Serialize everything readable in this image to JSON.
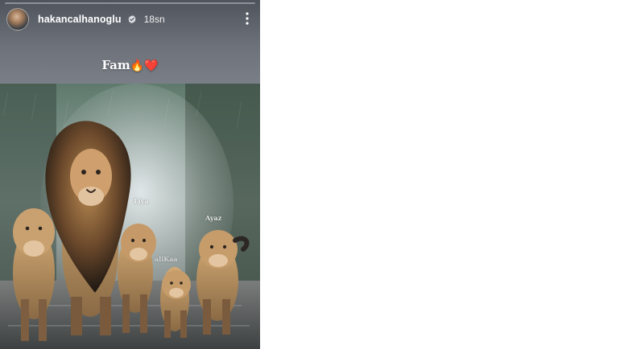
{
  "story": {
    "progress": 0.0,
    "user": {
      "username": "hakancalhanoglu",
      "verified": true,
      "time_ago": "18sn"
    },
    "caption": {
      "text": "Fam",
      "emojis": "🔥❤️"
    },
    "image": {
      "labels": {
        "liya": "Liya",
        "ayaz": "Ayaz",
        "third": "aliKaa"
      }
    }
  },
  "icons": {
    "verified": "verified-badge-icon",
    "more": "more-vertical-icon"
  },
  "colors": {
    "text": "#ffffff",
    "header_bg": "#5b6068"
  }
}
